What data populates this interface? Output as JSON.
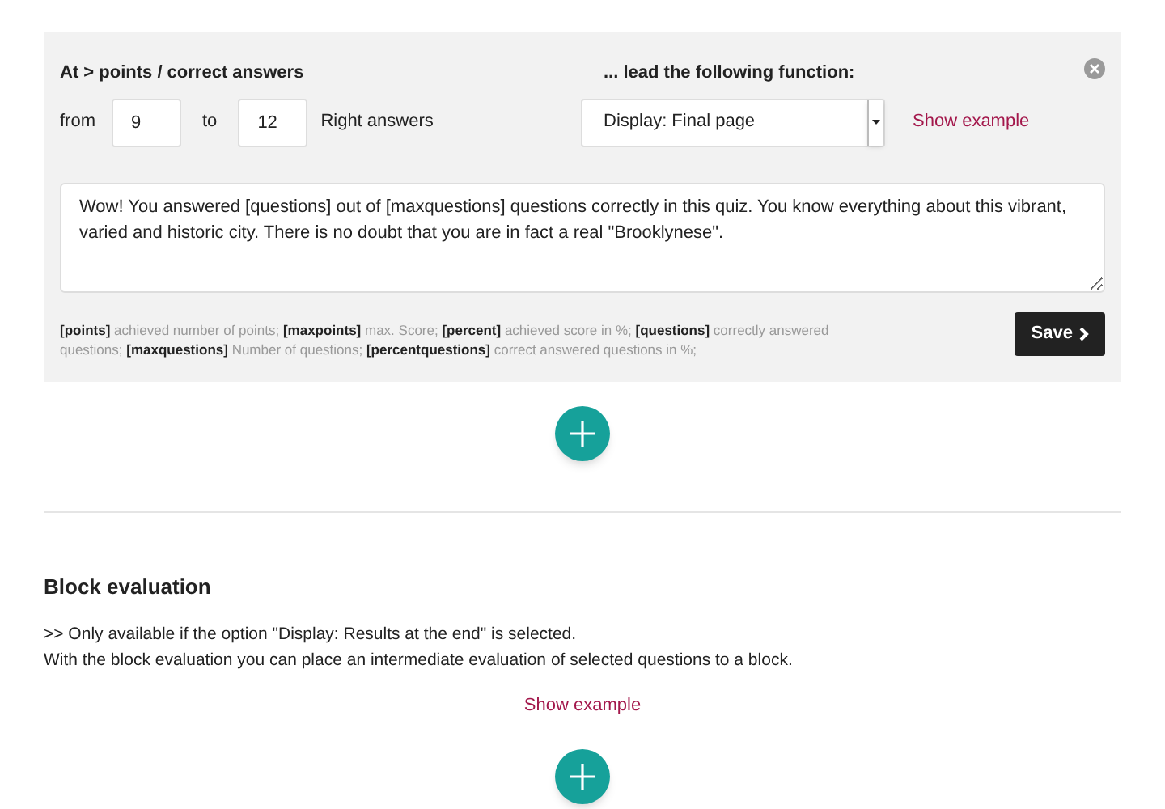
{
  "rule_panel": {
    "condition_heading": "At > points / correct answers",
    "function_heading": "... lead the following function:",
    "from_label": "from",
    "from_value": "9",
    "to_label": "to",
    "to_value": "12",
    "unit_label": "Right answers",
    "function_select": "Display: Final page",
    "show_example": "Show example",
    "message": "Wow! You answered [questions] out of [maxquestions] questions correctly in this quiz. You know everything about this vibrant, varied and historic city. There is no doubt that you are in fact a real \"Brooklynese\".",
    "legend": "**[points]** achieved number of points; **[maxpoints]** max. Score; **[percent]** achieved score in %; **[questions]** correctly answered questions; **[maxquestions]** Number of questions; **[percentquestions]** correct answered questions in %;",
    "save_button": "Save"
  },
  "block_evaluation": {
    "title": "Block evaluation",
    "lines": [
      ">> Only available if the option \"Display: Results at the end\" is selected.",
      "With the block evaluation you can place an intermediate evaluation of selected questions to a block."
    ],
    "show_example": "Show example"
  }
}
